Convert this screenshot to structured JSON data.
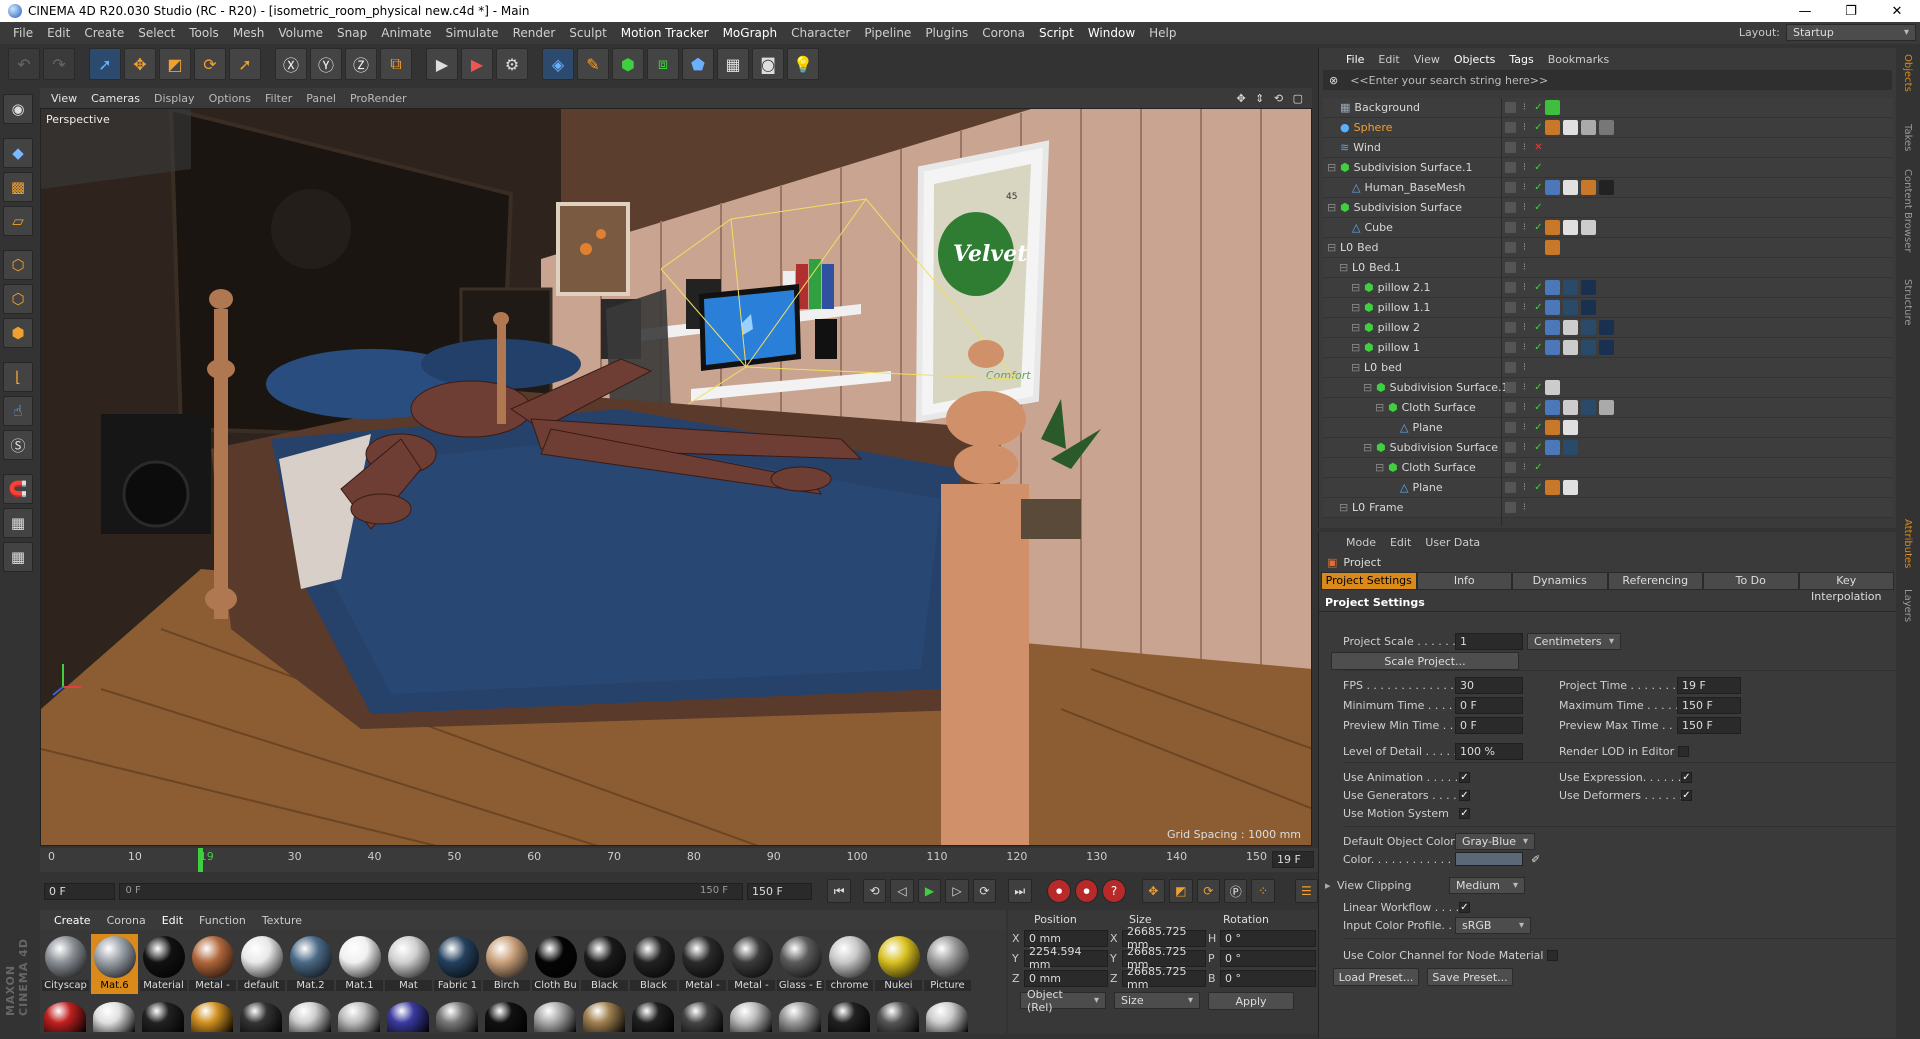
{
  "window": {
    "title": "CINEMA 4D R20.030 Studio (RC - R20) - [isometric_room_physical new.c4d *] - Main",
    "controls": [
      "—",
      "❐",
      "✕"
    ]
  },
  "menubar": {
    "items": [
      "File",
      "Edit",
      "Create",
      "Select",
      "Tools",
      "Mesh",
      "Volume",
      "Snap",
      "Animate",
      "Simulate",
      "Render",
      "Sculpt",
      "Motion Tracker",
      "MoGraph",
      "Character",
      "Pipeline",
      "Plugins",
      "Corona",
      "Script",
      "Window",
      "Help"
    ],
    "layout_label": "Layout:",
    "layout_value": "Startup"
  },
  "viewport": {
    "menu": [
      "View",
      "Cameras",
      "Display",
      "Options",
      "Filter",
      "Panel",
      "ProRender"
    ],
    "camera_label": "Perspective",
    "grid_spacing": "Grid Spacing : 1000 mm",
    "nav_icons": "✥ ⇕ ⟲ ▢"
  },
  "scene_text": {
    "poster_brand": "Velvet",
    "poster_sub": "Comfort",
    "poster_count": "45"
  },
  "timeline": {
    "ticks": [
      "0",
      "10",
      "19",
      "30",
      "40",
      "50",
      "60",
      "70",
      "80",
      "90",
      "100",
      "110",
      "120",
      "130",
      "140",
      "150"
    ],
    "current_frame": "19 F",
    "current_fraction": 0.1267
  },
  "playbar": {
    "start": "0 F",
    "range_start": "0 F",
    "range_end": "150 F",
    "end": "150 F"
  },
  "material_manager": {
    "menu": [
      "Create",
      "Corona",
      "Edit",
      "Function",
      "Texture"
    ],
    "materials": [
      {
        "name": "Cityscap",
        "color": "#8a8f96"
      },
      {
        "name": "Mat.6",
        "color": "#9aa0a8"
      },
      {
        "name": "Material",
        "color": "#111111"
      },
      {
        "name": "Metal -",
        "color": "#b0663a"
      },
      {
        "name": "default",
        "color": "#e8e8e8"
      },
      {
        "name": "Mat.2",
        "color": "#4a6a86"
      },
      {
        "name": "Mat.1",
        "color": "#f0f0f0"
      },
      {
        "name": "Mat",
        "color": "#d0d0d0"
      },
      {
        "name": "Fabric 1",
        "color": "#24405e"
      },
      {
        "name": "Birch",
        "color": "#c8a07a"
      },
      {
        "name": "Cloth Bu",
        "color": "#050505"
      },
      {
        "name": "Black",
        "color": "#1a1a1a"
      },
      {
        "name": "Black",
        "color": "#222222"
      },
      {
        "name": "Metal -",
        "color": "#2a2a2a"
      },
      {
        "name": "Metal -",
        "color": "#3a3a3a"
      },
      {
        "name": "Glass - E",
        "color": "#5a5a5a"
      },
      {
        "name": "chrome",
        "color": "#c8c8c8"
      },
      {
        "name": "Nukei",
        "color": "#d8c020"
      },
      {
        "name": "Picture",
        "color": "#9a9a9a"
      }
    ],
    "row2_colors": [
      "#c02020",
      "#e0e0e0",
      "#222222",
      "#d09020",
      "#333333",
      "#cfcfcf",
      "#bdbdbd",
      "#3a3aa0",
      "#777777",
      "#111111",
      "#aaaaaa",
      "#a08050",
      "#202020",
      "#444444",
      "#bbbbbb",
      "#999999",
      "#222222",
      "#555555",
      "#cccccc"
    ]
  },
  "coordinates": {
    "headers": [
      "Position",
      "Size",
      "Rotation"
    ],
    "rows": [
      {
        "axis": "X",
        "pos": "0 mm",
        "size_axis": "X",
        "size": "26685.725 mm",
        "rot_axis": "H",
        "rot": "0 °"
      },
      {
        "axis": "Y",
        "pos": "2254.594 mm",
        "size_axis": "Y",
        "size": "26685.725 mm",
        "rot_axis": "P",
        "rot": "0 °"
      },
      {
        "axis": "Z",
        "pos": "0 mm",
        "size_axis": "Z",
        "size": "26685.725 mm",
        "rot_axis": "B",
        "rot": "0 °"
      }
    ],
    "mode": "Object (Rel)",
    "size_mode": "Size",
    "apply": "Apply"
  },
  "object_manager": {
    "menu": [
      "File",
      "Edit",
      "View",
      "Objects",
      "Tags",
      "Bookmarks"
    ],
    "search_placeholder": "<<Enter your search string here>>",
    "objects": [
      {
        "name": "Background",
        "indent": 0,
        "icon": "▦",
        "icolor": "#9ab",
        "hl": false,
        "tags": [
          "#3fbf3f"
        ]
      },
      {
        "name": "Sphere",
        "indent": 0,
        "icon": "●",
        "icolor": "#5ab0ff",
        "hl": true,
        "tags": [
          "#c87828",
          "#e0e0e0",
          "#aaaaaa",
          "#777777"
        ]
      },
      {
        "name": "Wind",
        "indent": 0,
        "icon": "≋",
        "icolor": "#6aa0d0",
        "hl": false,
        "tags": []
      },
      {
        "name": "Subdivision Surface.1",
        "indent": 0,
        "icon": "⬢",
        "icolor": "#3fcf3f",
        "hl": false,
        "tags": []
      },
      {
        "name": "Human_BaseMesh",
        "indent": 1,
        "icon": "△",
        "icolor": "#5ab0ff",
        "hl": false,
        "tags": [
          "#4a78b8",
          "#e0e0e0",
          "#c87828",
          "#222222"
        ]
      },
      {
        "name": "Subdivision Surface",
        "indent": 0,
        "icon": "⬢",
        "icolor": "#3fcf3f",
        "hl": false,
        "tags": []
      },
      {
        "name": "Cube",
        "indent": 1,
        "icon": "△",
        "icolor": "#5ab0ff",
        "hl": false,
        "tags": [
          "#c87828",
          "#e0e0e0",
          "#cccccc"
        ]
      },
      {
        "name": "Bed",
        "indent": 0,
        "icon": "L0",
        "icolor": "#dddddd",
        "hl": false,
        "tags": [
          "#c87828"
        ]
      },
      {
        "name": "Bed.1",
        "indent": 1,
        "icon": "L0",
        "icolor": "#dddddd",
        "hl": false,
        "tags": []
      },
      {
        "name": "pillow 2.1",
        "indent": 2,
        "icon": "⬢",
        "icolor": "#3fcf3f",
        "hl": false,
        "tags": [
          "#4a78b8",
          "#2a4a6a",
          "#1a3050"
        ]
      },
      {
        "name": "pillow 1.1",
        "indent": 2,
        "icon": "⬢",
        "icolor": "#3fcf3f",
        "hl": false,
        "tags": [
          "#4a78b8",
          "#2a4a6a",
          "#1a3050"
        ]
      },
      {
        "name": "pillow 2",
        "indent": 2,
        "icon": "⬢",
        "icolor": "#3fcf3f",
        "hl": false,
        "tags": [
          "#4a78b8",
          "#cccccc",
          "#2a4a6a",
          "#1a3050"
        ]
      },
      {
        "name": "pillow 1",
        "indent": 2,
        "icon": "⬢",
        "icolor": "#3fcf3f",
        "hl": false,
        "tags": [
          "#4a78b8",
          "#cccccc",
          "#2a4a6a",
          "#1a3050"
        ]
      },
      {
        "name": "bed",
        "indent": 2,
        "icon": "L0",
        "icolor": "#dddddd",
        "hl": false,
        "tags": []
      },
      {
        "name": "Subdivision Surface.1",
        "indent": 3,
        "icon": "⬢",
        "icolor": "#3fcf3f",
        "hl": false,
        "tags": [
          "#cccccc"
        ]
      },
      {
        "name": "Cloth Surface",
        "indent": 4,
        "icon": "⬢",
        "icolor": "#3fcf3f",
        "hl": false,
        "tags": [
          "#4a78b8",
          "#cccccc",
          "#2a4a6a",
          "#aaaaaa"
        ]
      },
      {
        "name": "Plane",
        "indent": 5,
        "icon": "△",
        "icolor": "#5ab0ff",
        "hl": false,
        "tags": [
          "#c87828",
          "#e0e0e0"
        ]
      },
      {
        "name": "Subdivision Surface",
        "indent": 3,
        "icon": "⬢",
        "icolor": "#3fcf3f",
        "hl": false,
        "tags": [
          "#4a78b8",
          "#2a4a6a"
        ]
      },
      {
        "name": "Cloth Surface",
        "indent": 4,
        "icon": "⬢",
        "icolor": "#3fcf3f",
        "hl": false,
        "tags": []
      },
      {
        "name": "Plane",
        "indent": 5,
        "icon": "△",
        "icolor": "#5ab0ff",
        "hl": false,
        "tags": [
          "#c87828",
          "#e0e0e0"
        ]
      },
      {
        "name": "Frame",
        "indent": 1,
        "icon": "L0",
        "icolor": "#dddddd",
        "hl": false,
        "tags": []
      }
    ]
  },
  "attribute_manager": {
    "menu": [
      "Mode",
      "Edit",
      "User Data"
    ],
    "title": "Project",
    "tabs": [
      "Project Settings",
      "Info",
      "Dynamics",
      "Referencing",
      "To Do",
      "Key Interpolation"
    ],
    "section": "Project Settings",
    "project_scale_label": "Project Scale . . . . . . .",
    "project_scale": "1",
    "scale_unit": "Centimeters",
    "scale_button": "Scale Project...",
    "fps_label": "FPS . . . . . . . . . . . . . . .",
    "fps": "30",
    "min_time_label": "Minimum Time . . . . . .",
    "min_time": "0 F",
    "prev_min_label": "Preview Min Time . . . .",
    "prev_min": "0 F",
    "lod_label": "Level of Detail . . . . . .",
    "lod": "100 %",
    "proj_time_label": "Project Time . . . . . . . .",
    "proj_time": "19 F",
    "max_time_label": "Maximum Time . . . . . .",
    "max_time": "150 F",
    "prev_max_label": "Preview Max Time . . . .",
    "prev_max": "150 F",
    "render_lod_label": "Render LOD in Editor",
    "use_anim_label": "Use Animation . . . . . .",
    "use_gen_label": "Use Generators . . . . . .",
    "use_motion_label": "Use Motion System",
    "use_expr_label": "Use Expression. . . . . .",
    "use_def_label": "Use Deformers . . . . . .",
    "def_color_label": "Default Object Color",
    "def_color": "Gray-Blue",
    "color_label": "Color. . . . . . . . . . . . .",
    "view_clip_label": "View Clipping",
    "view_clip": "Medium",
    "linear_label": "Linear Workflow . . . .",
    "input_profile_label": "Input Color Profile. . .",
    "input_profile": "sRGB",
    "color_channel_label": "Use Color Channel for Node Material",
    "load_preset": "Load Preset...",
    "save_preset": "Save Preset..."
  },
  "right_tabs": [
    "Objects",
    "Takes",
    "Content Browser",
    "Structure",
    "Attributes",
    "Layers"
  ]
}
